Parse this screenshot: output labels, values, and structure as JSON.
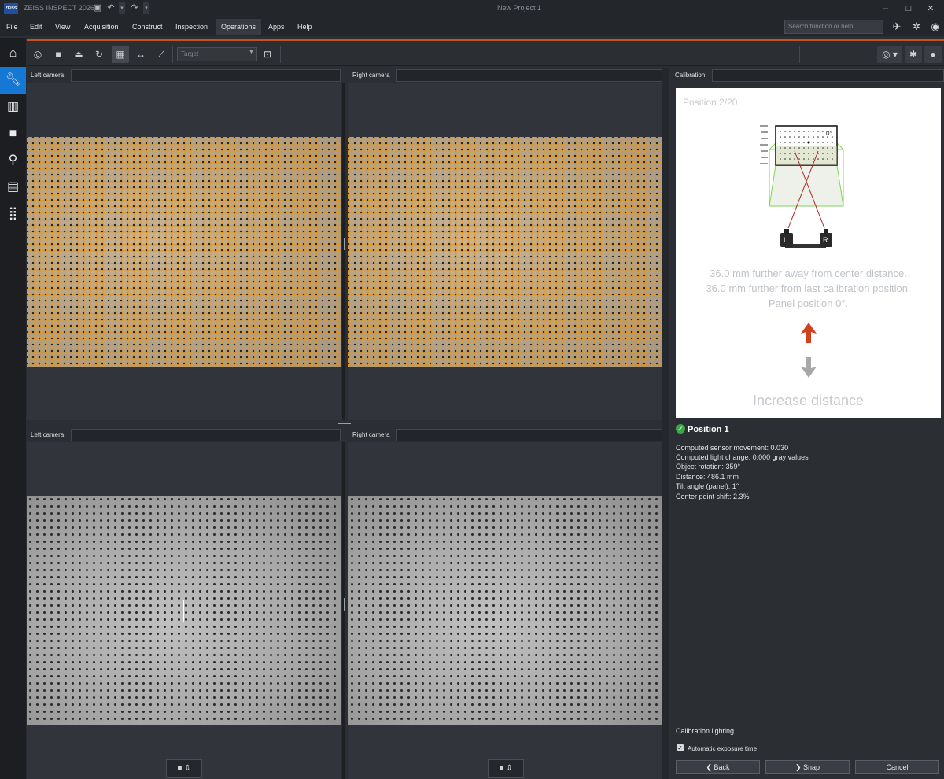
{
  "app": {
    "logo_text": "ZEISS",
    "title": "ZEISS INSPECT 2026",
    "project_title": "New Project 1"
  },
  "menu": [
    "File",
    "Edit",
    "View",
    "Acquisition",
    "Construct",
    "Inspection",
    "Operations",
    "Apps",
    "Help"
  ],
  "search": {
    "placeholder": "Search function or help"
  },
  "toolbar": {
    "target_placeholder": "Target"
  },
  "panes": {
    "top_left": "Left camera",
    "top_right": "Right camera",
    "bottom_left": "Left camera",
    "bottom_right": "Right camera"
  },
  "calibration": {
    "header": "Calibration",
    "position": "Position 2/20",
    "diagram_angle": "0°",
    "diagram_left": "L",
    "diagram_right": "R",
    "line1": "36.0 mm further away from center distance.",
    "line2": "36.0 mm further from last calibration position.",
    "line3": "Panel position 0°.",
    "action": "Increase distance",
    "result_title": "Position 1",
    "results": [
      "Computed sensor movement: 0.030",
      "Computed light change: 0.000 gray values",
      "Object rotation: 359°",
      "Distance: 486.1 mm",
      "Tilt angle (panel): 1°",
      "Center point shift: 2.3%"
    ],
    "lighting_label": "Calibration lighting",
    "auto_exposure": "Automatic exposure time",
    "auto_exposure_checked": true,
    "buttons": {
      "back": "Back",
      "snap": "Snap",
      "cancel": "Cancel"
    }
  },
  "colors": {
    "accent": "#1478d4",
    "orange_bar": "#c4521c",
    "arrow_up": "#d2401c",
    "arrow_down": "#a8a8a8",
    "check": "#3aa845"
  }
}
